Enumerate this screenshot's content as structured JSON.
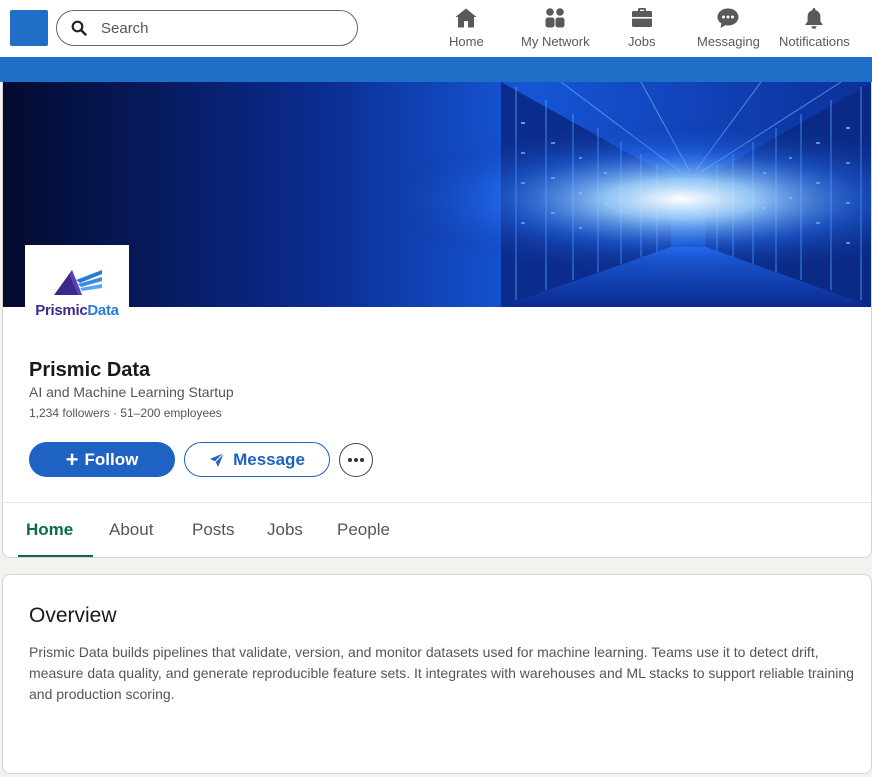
{
  "search": {
    "placeholder": "Search"
  },
  "nav": {
    "home": "Home",
    "network": "My Network",
    "jobs": "Jobs",
    "messaging": "Messaging",
    "notifications": "Notifications"
  },
  "company": {
    "logo_text_a": "Prismic",
    "logo_text_b": "Data",
    "name": "Prismic Data",
    "tagline": "AI and Machine Learning Startup",
    "meta": "1,234 followers · 51–200 employees"
  },
  "actions": {
    "follow": "Follow",
    "message": "Message"
  },
  "tabs": [
    "Home",
    "About",
    "Posts",
    "Jobs",
    "People"
  ],
  "overview": {
    "title": "Overview",
    "body": "Prismic Data builds pipelines that validate, version, and monitor datasets used for machine learning. Teams use it to detect drift, measure data quality, and generate reproducible feature sets. It integrates with warehouses and ML stacks to support reliable training and production scoring."
  },
  "colors": {
    "brand_blue": "#1e63c4",
    "active_tab": "#0b6a4f"
  }
}
